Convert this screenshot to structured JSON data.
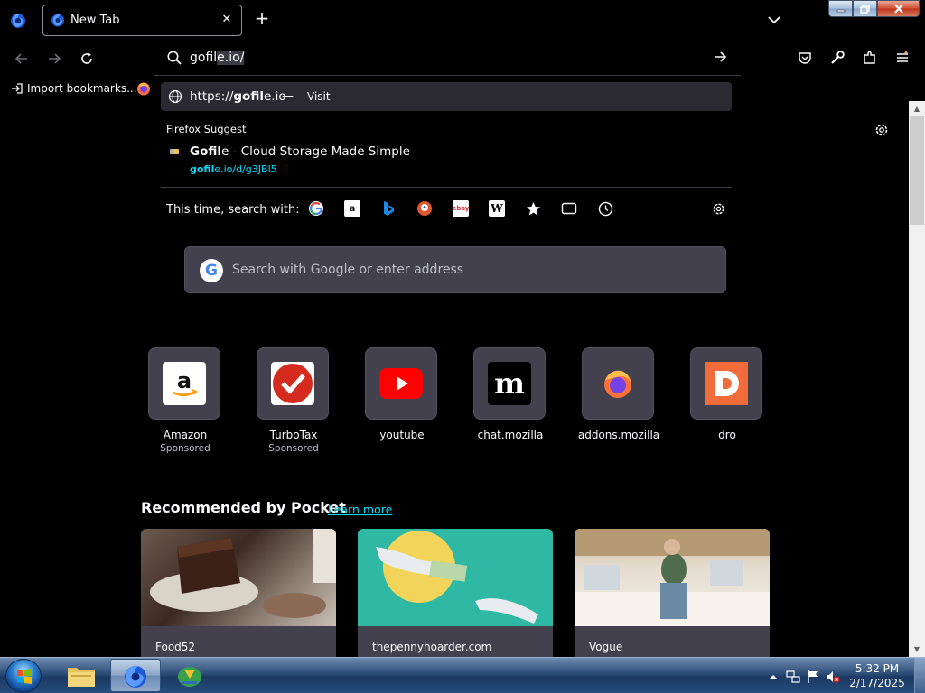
{
  "window": {
    "tab_title": "New Tab"
  },
  "urlbar": {
    "typed_prefix": "gofil",
    "autofill": "e.io/",
    "visit_url_prefix": "https://",
    "visit_url_bold": "gofil",
    "visit_url_suffix": "e.io",
    "visit_sep": "—",
    "visit_action": "Visit",
    "suggest_heading": "Firefox Suggest",
    "suggestion_title_bold": "Gofil",
    "suggestion_title_rest": "e - Cloud Storage Made Simple",
    "suggestion_url_bold": "gofil",
    "suggestion_url_rest": "e.io/d/g3JBl5",
    "search_with_label": "This time, search with:",
    "engines": [
      "google",
      "amazon",
      "bing",
      "duckduckgo",
      "ebay",
      "wikipedia",
      "bookmarks",
      "tabs",
      "history"
    ]
  },
  "bookmarks": {
    "import_label": "Import bookmarks..."
  },
  "newtab": {
    "search_placeholder": "Search with Google or enter address",
    "tiles": [
      {
        "label": "Amazon",
        "sponsor": "Sponsored"
      },
      {
        "label": "TurboTax",
        "sponsor": "Sponsored"
      },
      {
        "label": "youtube",
        "sponsor": ""
      },
      {
        "label": "chat.mozilla",
        "sponsor": ""
      },
      {
        "label": "addons.mozilla",
        "sponsor": ""
      },
      {
        "label": "dro",
        "sponsor": ""
      }
    ],
    "pocket_title": "Recommended by Pocket",
    "pocket_learn": "Learn more",
    "cards": [
      {
        "source": "Food52"
      },
      {
        "source": "thepennyhoarder.com"
      },
      {
        "source": "Vogue"
      }
    ]
  },
  "taskbar": {
    "time": "5:32 PM",
    "date": "2/17/2025"
  },
  "colors": {
    "accent": "#00ddff",
    "panel": "#42414d",
    "background": "#000000"
  }
}
